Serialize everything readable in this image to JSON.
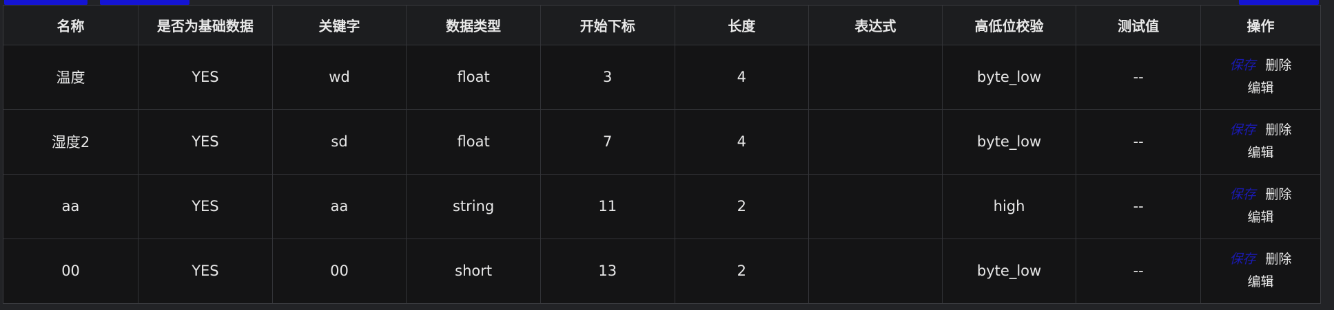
{
  "colors": {
    "background": "#222326",
    "table_body": "#141415",
    "header_bg": "#1c1d1f",
    "accent_blue": "#1414d4",
    "save_link": "#1a1ab0"
  },
  "table": {
    "headers": [
      "名称",
      "是否为基础数据",
      "关键字",
      "数据类型",
      "开始下标",
      "长度",
      "表达式",
      "高低位校验",
      "测试值",
      "操作"
    ],
    "rows": [
      [
        "温度",
        "YES",
        "wd",
        "float",
        "3",
        "4",
        "",
        "byte_low",
        "--"
      ],
      [
        "湿度2",
        "YES",
        "sd",
        "float",
        "7",
        "4",
        "",
        "byte_low",
        "--"
      ],
      [
        "aa",
        "YES",
        "aa",
        "string",
        "11",
        "2",
        "",
        "high",
        "--"
      ],
      [
        "00",
        "YES",
        "00",
        "short",
        "13",
        "2",
        "",
        "byte_low",
        "--"
      ]
    ],
    "actions": {
      "save": "保存",
      "delete": "删除",
      "edit": "编辑"
    }
  }
}
